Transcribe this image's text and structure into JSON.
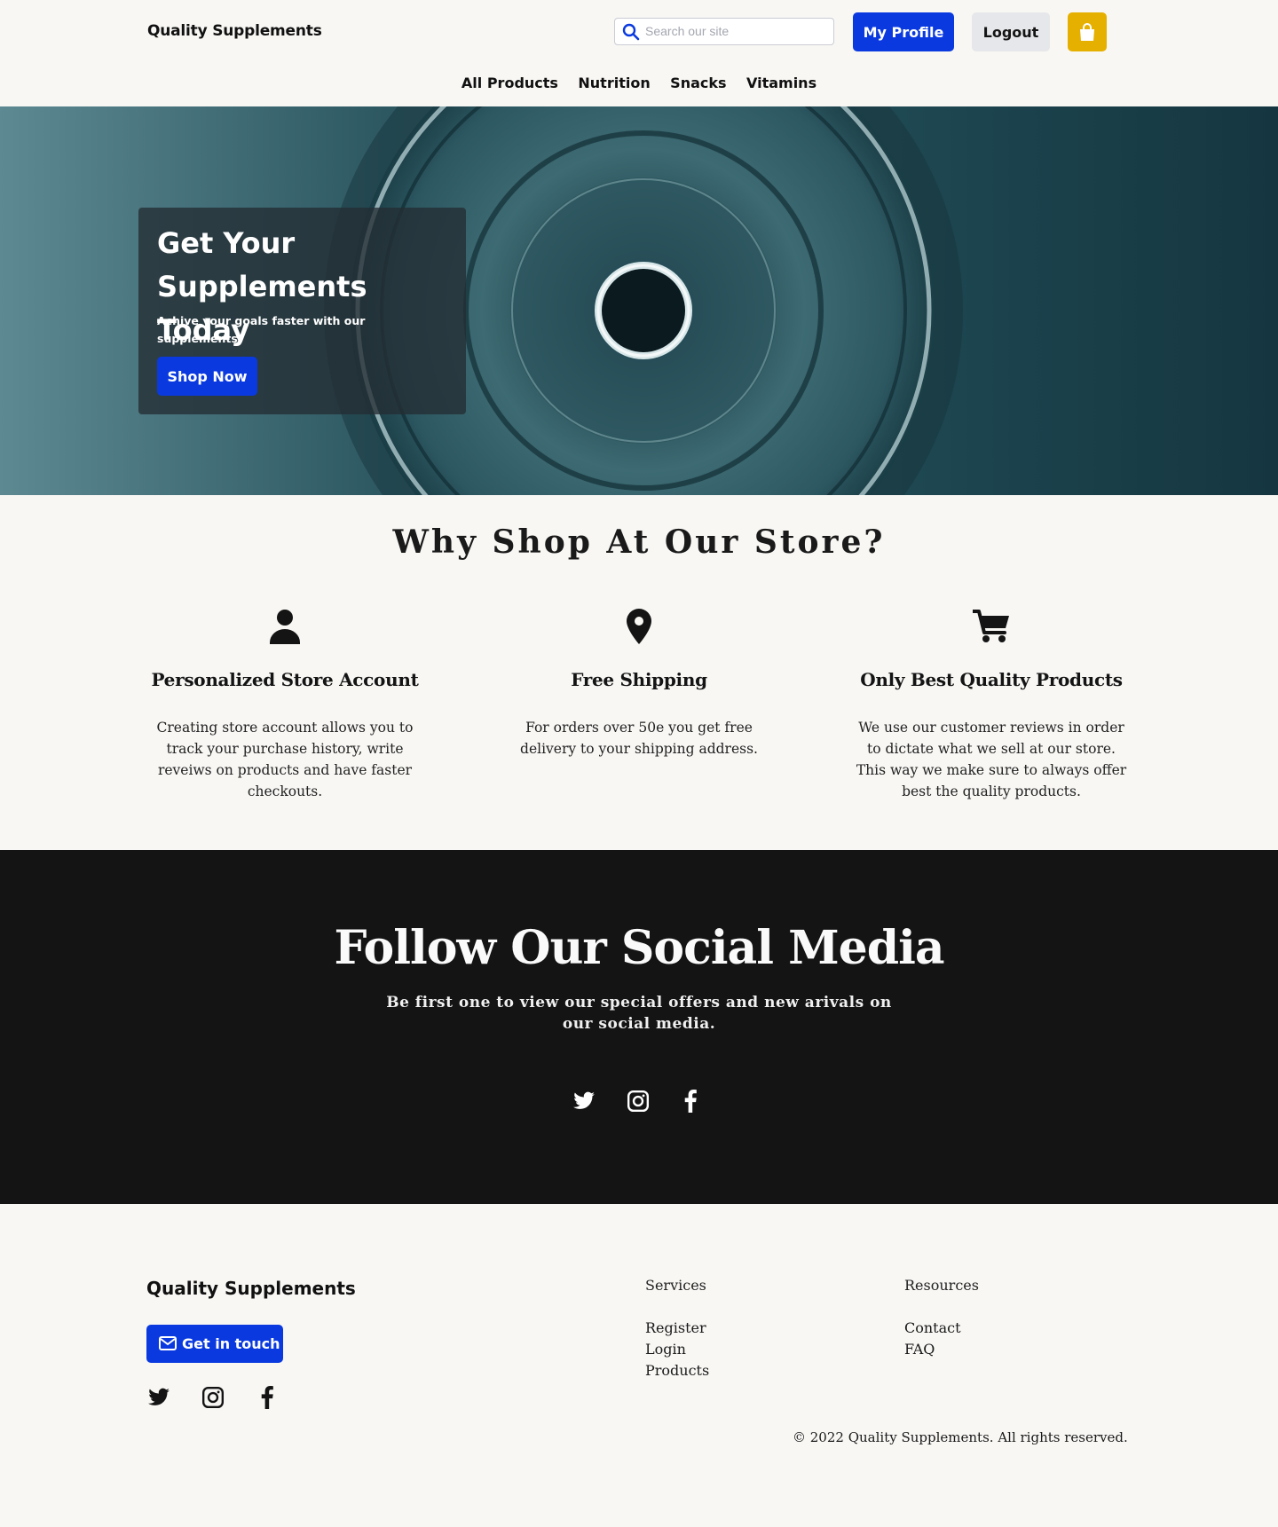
{
  "header": {
    "brand": "Quality Supplements",
    "search_placeholder": "Search our site",
    "profile_label": "My Profile",
    "logout_label": "Logout",
    "cart_icon": "shopping-bag-icon",
    "nav": [
      "All Products",
      "Nutrition",
      "Snacks",
      "Vitamins"
    ]
  },
  "hero": {
    "title": "Get Your Supplements Today",
    "subtitle": "Achive your goals faster with our supplements.",
    "cta_label": "Shop Now"
  },
  "why": {
    "title": "Why Shop At Our Store?",
    "features": [
      {
        "icon": "user-icon",
        "title": "Personalized Store Account",
        "text": "Creating store account allows you to track your purchase history, write reveiws on products and have faster checkouts."
      },
      {
        "icon": "map-pin-icon",
        "title": "Free Shipping",
        "text": "For orders over 50e you get free delivery to your shipping address."
      },
      {
        "icon": "cart-icon",
        "title": "Only Best Quality Products",
        "text": "We use our customer reviews in order to dictate what we sell at our store. This way we make sure to always offer best the quality products."
      }
    ]
  },
  "social": {
    "title": "Follow Our Social Media",
    "subtitle": "Be first one to view our special offers and new arivals on our social media.",
    "icons": [
      "twitter-icon",
      "instagram-icon",
      "facebook-icon"
    ]
  },
  "footer": {
    "brand": "Quality Supplements",
    "contact_label": "Get in touch",
    "services": {
      "heading": "Services",
      "links": [
        "Register",
        "Login",
        "Products"
      ]
    },
    "resources": {
      "heading": "Resources",
      "links": [
        "Contact",
        "FAQ"
      ]
    },
    "copyright": "© 2022 Quality Supplements. All rights reserved."
  },
  "colors": {
    "primary": "#0a3adf",
    "cart": "#e6b000",
    "dark": "#141414",
    "background": "#f8f7f4"
  }
}
